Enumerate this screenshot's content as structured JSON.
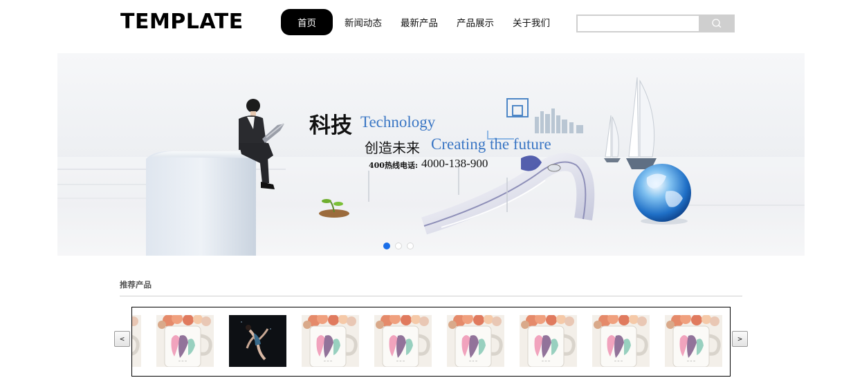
{
  "header": {
    "logo": "TEMPLATE",
    "nav": [
      {
        "label": "首页",
        "active": true
      },
      {
        "label": "新闻动态",
        "active": false
      },
      {
        "label": "最新产品",
        "active": false
      },
      {
        "label": "产品展示",
        "active": false
      },
      {
        "label": "关于我们",
        "active": false
      }
    ],
    "search": {
      "placeholder": "",
      "button_icon": "search-icon"
    }
  },
  "banner": {
    "headline_cn": "科技",
    "headline_en": "Technology",
    "subline_cn": "创造未来",
    "subline_en": "Creating the future",
    "hotline_label": "400热线电话:",
    "hotline_number": "4000-138-900",
    "slide_count": 3,
    "active_slide": 1,
    "accent_color": "#1a6ee8"
  },
  "products": {
    "title": "推荐产品",
    "prev_label": "<",
    "next_label": ">",
    "items": [
      {
        "image": "mug-icon"
      },
      {
        "image": "mug-icon"
      },
      {
        "image": "dancer-photo"
      },
      {
        "image": "mug-icon"
      },
      {
        "image": "mug-icon"
      },
      {
        "image": "mug-icon"
      },
      {
        "image": "mug-icon"
      },
      {
        "image": "mug-icon"
      },
      {
        "image": "mug-icon"
      }
    ]
  }
}
